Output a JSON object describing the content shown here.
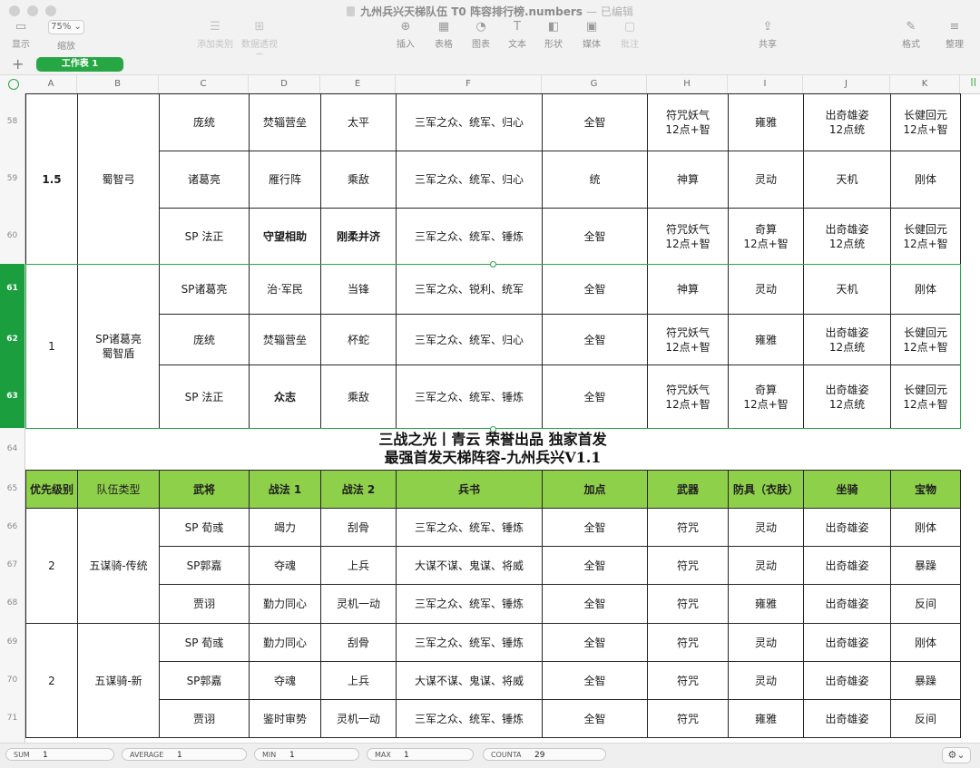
{
  "window": {
    "title": "九州兵兴天梯队伍 T0 阵容排行榜.numbers",
    "edited": "— 已编辑"
  },
  "toolbar": {
    "zoom": "75%",
    "items": [
      {
        "label": "显示",
        "icon": "sidebar-icon",
        "glyph": "▭"
      },
      {
        "label": "缩放",
        "icon": "zoom-icon",
        "glyph": ""
      },
      {
        "label": "添加类别",
        "icon": "add-category-icon",
        "glyph": "☰"
      },
      {
        "label": "数据透视表",
        "icon": "pivot-table-icon",
        "glyph": "⊞"
      },
      {
        "label": "插入",
        "icon": "insert-icon",
        "glyph": "⊕"
      },
      {
        "label": "表格",
        "icon": "table-icon",
        "glyph": "▦"
      },
      {
        "label": "图表",
        "icon": "chart-icon",
        "glyph": "◔"
      },
      {
        "label": "文本",
        "icon": "text-icon",
        "glyph": "T"
      },
      {
        "label": "形状",
        "icon": "shape-icon",
        "glyph": "◧"
      },
      {
        "label": "媒体",
        "icon": "media-icon",
        "glyph": "▣"
      },
      {
        "label": "批注",
        "icon": "comment-icon",
        "glyph": "▢"
      },
      {
        "label": "共享",
        "icon": "share-icon",
        "glyph": "⇪"
      },
      {
        "label": "格式",
        "icon": "format-brush-icon",
        "glyph": "✎"
      },
      {
        "label": "整理",
        "icon": "organize-icon",
        "glyph": "≡"
      }
    ]
  },
  "sheet_tab": "工作表 1",
  "columns": [
    "A",
    "B",
    "C",
    "D",
    "E",
    "F",
    "G",
    "H",
    "I",
    "J",
    "K"
  ],
  "rows_upper": [
    [
      "",
      "",
      "庞统",
      "焚辎营垒",
      "太平",
      "三军之众、统军、归心",
      "全智",
      "符咒妖气\n12点+智",
      "雍雅",
      "出奇雄姿\n12点统",
      "长健回元\n12点+智"
    ],
    [
      "1.5",
      "蜀智弓",
      "诸葛亮",
      "雁行阵",
      "乘敌",
      "三军之众、统军、归心",
      "统",
      "神算",
      "灵动",
      "天机",
      "刚体"
    ],
    [
      "",
      "",
      "SP 法正",
      "守望相助",
      "刚柔并济",
      "三军之众、统军、锤炼",
      "全智",
      "符咒妖气\n12点+智",
      "奇算\n12点+智",
      "出奇雄姿\n12点统",
      "长健回元\n12点+智"
    ],
    [
      "",
      "",
      "SP诸葛亮",
      "治·军民",
      "当锋",
      "三军之众、锐利、统军",
      "全智",
      "神算",
      "灵动",
      "天机",
      "刚体"
    ],
    [
      "1",
      "SP诸葛亮\n蜀智盾",
      "庞统",
      "焚辎营垒",
      "杯蛇",
      "三军之众、统军、归心",
      "全智",
      "符咒妖气\n12点+智",
      "雍雅",
      "出奇雄姿\n12点统",
      "长健回元\n12点+智"
    ],
    [
      "",
      "",
      "SP 法正",
      "众志",
      "乘敌",
      "三军之众、统军、锤炼",
      "全智",
      "符咒妖气\n12点+智",
      "奇算\n12点+智",
      "出奇雄姿\n12点统",
      "长健回元\n12点+智"
    ]
  ],
  "banner": {
    "line1": "三战之光丨青云 荣誉出品 独家首发",
    "line2": "最强首发天梯阵容-九州兵兴V1.1"
  },
  "header_row": [
    "优先级别",
    "队伍类型",
    "武将",
    "战法 1",
    "战法 2",
    "兵书",
    "加点",
    "武器",
    "防具（衣肤）",
    "坐骑",
    "宝物"
  ],
  "rows_lower": [
    [
      "",
      "",
      "SP 荀彧",
      "竭力",
      "刮骨",
      "三军之众、统军、锤炼",
      "全智",
      "符咒",
      "灵动",
      "出奇雄姿",
      "刚体"
    ],
    [
      "2",
      "五谋骑-传统",
      "SP郭嘉",
      "夺魂",
      "上兵",
      "大谋不谋、鬼谋、将威",
      "全智",
      "符咒",
      "灵动",
      "出奇雄姿",
      "暴躁"
    ],
    [
      "",
      "",
      "贾诩",
      "勤力同心",
      "灵机一动",
      "三军之众、统军、锤炼",
      "全智",
      "符咒",
      "雍雅",
      "出奇雄姿",
      "反间"
    ],
    [
      "",
      "",
      "SP 荀彧",
      "勤力同心",
      "刮骨",
      "三军之众、统军、锤炼",
      "全智",
      "符咒",
      "灵动",
      "出奇雄姿",
      "刚体"
    ],
    [
      "2",
      "五谋骑-新",
      "SP郭嘉",
      "夺魂",
      "上兵",
      "大谋不谋、鬼谋、将威",
      "全智",
      "符咒",
      "灵动",
      "出奇雄姿",
      "暴躁"
    ],
    [
      "",
      "",
      "贾诩",
      "鉴时审势",
      "灵机一动",
      "三军之众、统军、锤炼",
      "全智",
      "符咒",
      "雍雅",
      "出奇雄姿",
      "反间"
    ]
  ],
  "row_numbers": [
    "58",
    "59",
    "60",
    "61",
    "62",
    "63",
    "64",
    "65",
    "66",
    "67",
    "68",
    "69",
    "70",
    "71"
  ],
  "status": {
    "sum_label": "SUM",
    "sum": "1",
    "avg_label": "AVERAGE",
    "avg": "1",
    "min_label": "MIN",
    "min": "1",
    "max_label": "MAX",
    "max": "1",
    "count_label": "COUNTA",
    "count": "29"
  },
  "colors": {
    "accent": "#27a744",
    "header_fill": "#8fd04a",
    "selected_row": "#1b9e3e"
  }
}
